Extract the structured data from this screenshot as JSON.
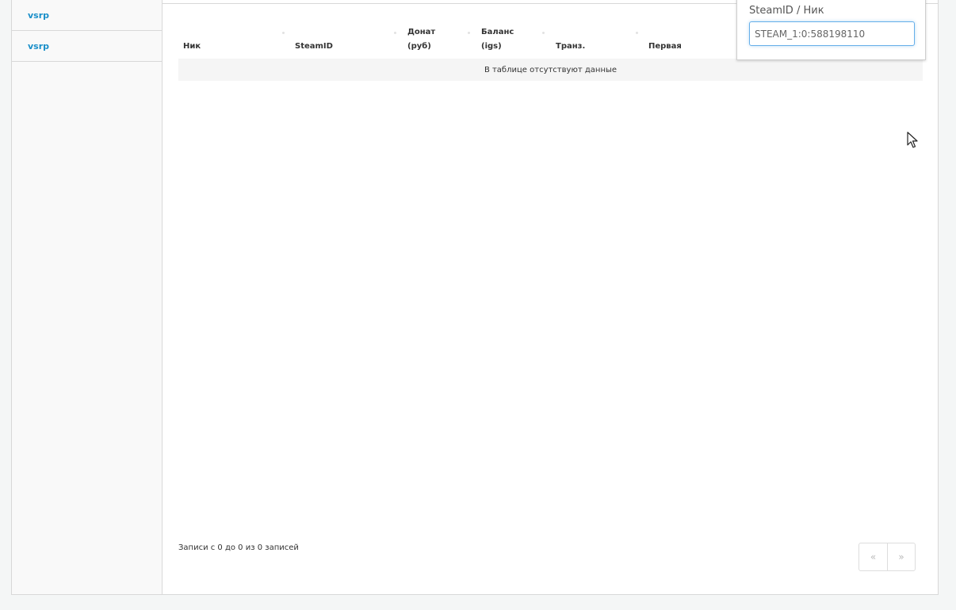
{
  "sidebar": {
    "items": [
      {
        "label": "vsrp"
      },
      {
        "label": "vsrp"
      }
    ]
  },
  "table": {
    "columns": [
      {
        "line1": "",
        "line2": "Ник"
      },
      {
        "line1": "",
        "line2": "SteamID"
      },
      {
        "line1": "Донат",
        "line2": "(руб)"
      },
      {
        "line1": "Баланс",
        "line2": "(igs)"
      },
      {
        "line1": "",
        "line2": "Транз."
      },
      {
        "line1": "",
        "line2": "Первая"
      }
    ],
    "empty_message": "В таблице отсутствуют данные"
  },
  "footer": {
    "info": "Записи с 0 до 0 из 0 записей",
    "prev": "«",
    "next": "»"
  },
  "search_popup": {
    "label": "SteamID / Ник",
    "value": "STEAM_1:0:588198110"
  },
  "colors": {
    "link": "#1a8fc9",
    "input_focus": "#66afe9"
  },
  "icons": {
    "cursor": "mouse-pointer-icon",
    "sort": "sort-indicator-icon"
  }
}
